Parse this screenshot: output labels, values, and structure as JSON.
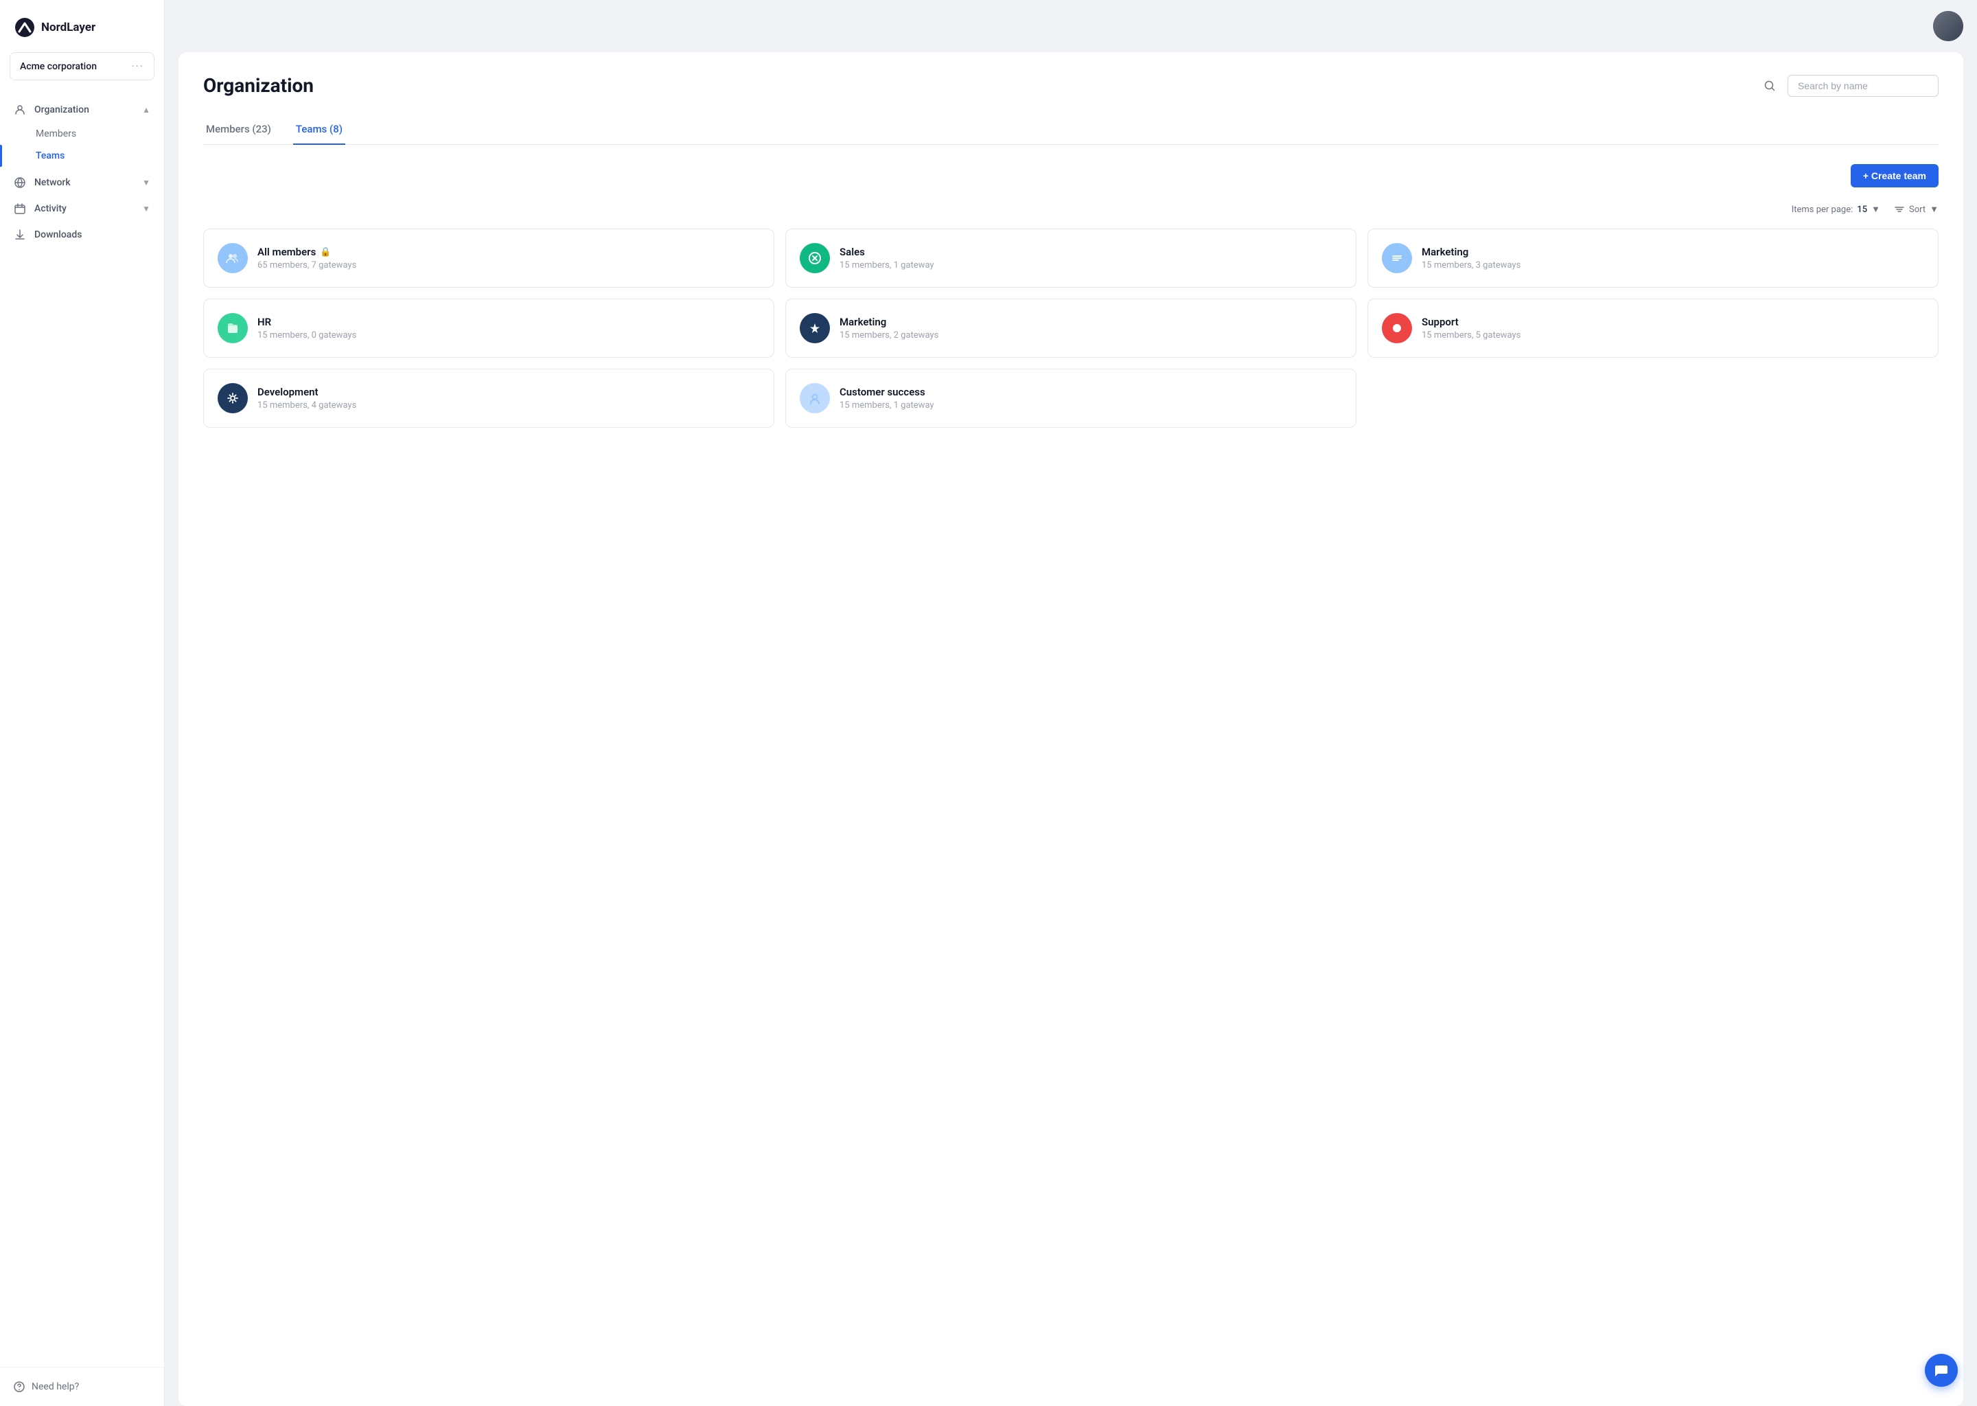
{
  "app": {
    "name": "NordLayer"
  },
  "org": {
    "name": "Acme corporation",
    "options_label": "···"
  },
  "sidebar": {
    "nav_items": [
      {
        "id": "organization",
        "label": "Organization",
        "icon": "org-icon",
        "expandable": true,
        "expanded": true
      },
      {
        "id": "network",
        "label": "Network",
        "icon": "network-icon",
        "expandable": true,
        "expanded": false
      },
      {
        "id": "activity",
        "label": "Activity",
        "icon": "activity-icon",
        "expandable": true,
        "expanded": false
      },
      {
        "id": "downloads",
        "label": "Downloads",
        "icon": "download-icon",
        "expandable": false,
        "expanded": false
      }
    ],
    "org_sub_items": [
      {
        "id": "members",
        "label": "Members"
      },
      {
        "id": "teams",
        "label": "Teams"
      }
    ],
    "footer": {
      "help_label": "Need help?"
    }
  },
  "page": {
    "title": "Organization",
    "search_placeholder": "Search by name"
  },
  "tabs": [
    {
      "id": "members",
      "label": "Members",
      "count": 23,
      "active": false
    },
    {
      "id": "teams",
      "label": "Teams",
      "count": 8,
      "active": true
    }
  ],
  "toolbar": {
    "create_team_label": "+ Create team"
  },
  "list_controls": {
    "items_per_page_label": "Items per page:",
    "items_per_page_value": "15",
    "sort_label": "Sort"
  },
  "teams": [
    {
      "id": "all-members",
      "name": "All members",
      "locked": true,
      "members": 65,
      "gateways": 7,
      "meta": "65 members, 7 gateways",
      "avatar_bg": "#93c5fd",
      "avatar_icon": "people"
    },
    {
      "id": "sales",
      "name": "Sales",
      "locked": false,
      "members": 15,
      "gateways": 1,
      "meta": "15 members, 1 gateway",
      "avatar_bg": "#10b981",
      "avatar_icon": "x"
    },
    {
      "id": "marketing-1",
      "name": "Marketing",
      "locked": false,
      "members": 15,
      "gateways": 3,
      "meta": "15 members, 3 gateways",
      "avatar_bg": "#93c5fd",
      "avatar_icon": "lines"
    },
    {
      "id": "hr",
      "name": "HR",
      "locked": false,
      "members": 15,
      "gateways": 0,
      "meta": "15 members, 0 gateways",
      "avatar_bg": "#34d399",
      "avatar_icon": "folder"
    },
    {
      "id": "marketing-2",
      "name": "Marketing",
      "locked": false,
      "members": 15,
      "gateways": 2,
      "meta": "15 members, 2 gateways",
      "avatar_bg": "#1e3a5f",
      "avatar_icon": "star"
    },
    {
      "id": "support",
      "name": "Support",
      "locked": false,
      "members": 15,
      "gateways": 5,
      "meta": "15 members, 5 gateways",
      "avatar_bg": "#ef4444",
      "avatar_icon": "circle"
    },
    {
      "id": "development",
      "name": "Development",
      "locked": false,
      "members": 15,
      "gateways": 4,
      "meta": "15 members, 4 gateways",
      "avatar_bg": "#1e3a5f",
      "avatar_icon": "gear"
    },
    {
      "id": "customer-success",
      "name": "Customer success",
      "locked": false,
      "members": 15,
      "gateways": 1,
      "meta": "15 members, 1 gateway",
      "avatar_bg": "#bfdbfe",
      "avatar_icon": "person"
    }
  ]
}
